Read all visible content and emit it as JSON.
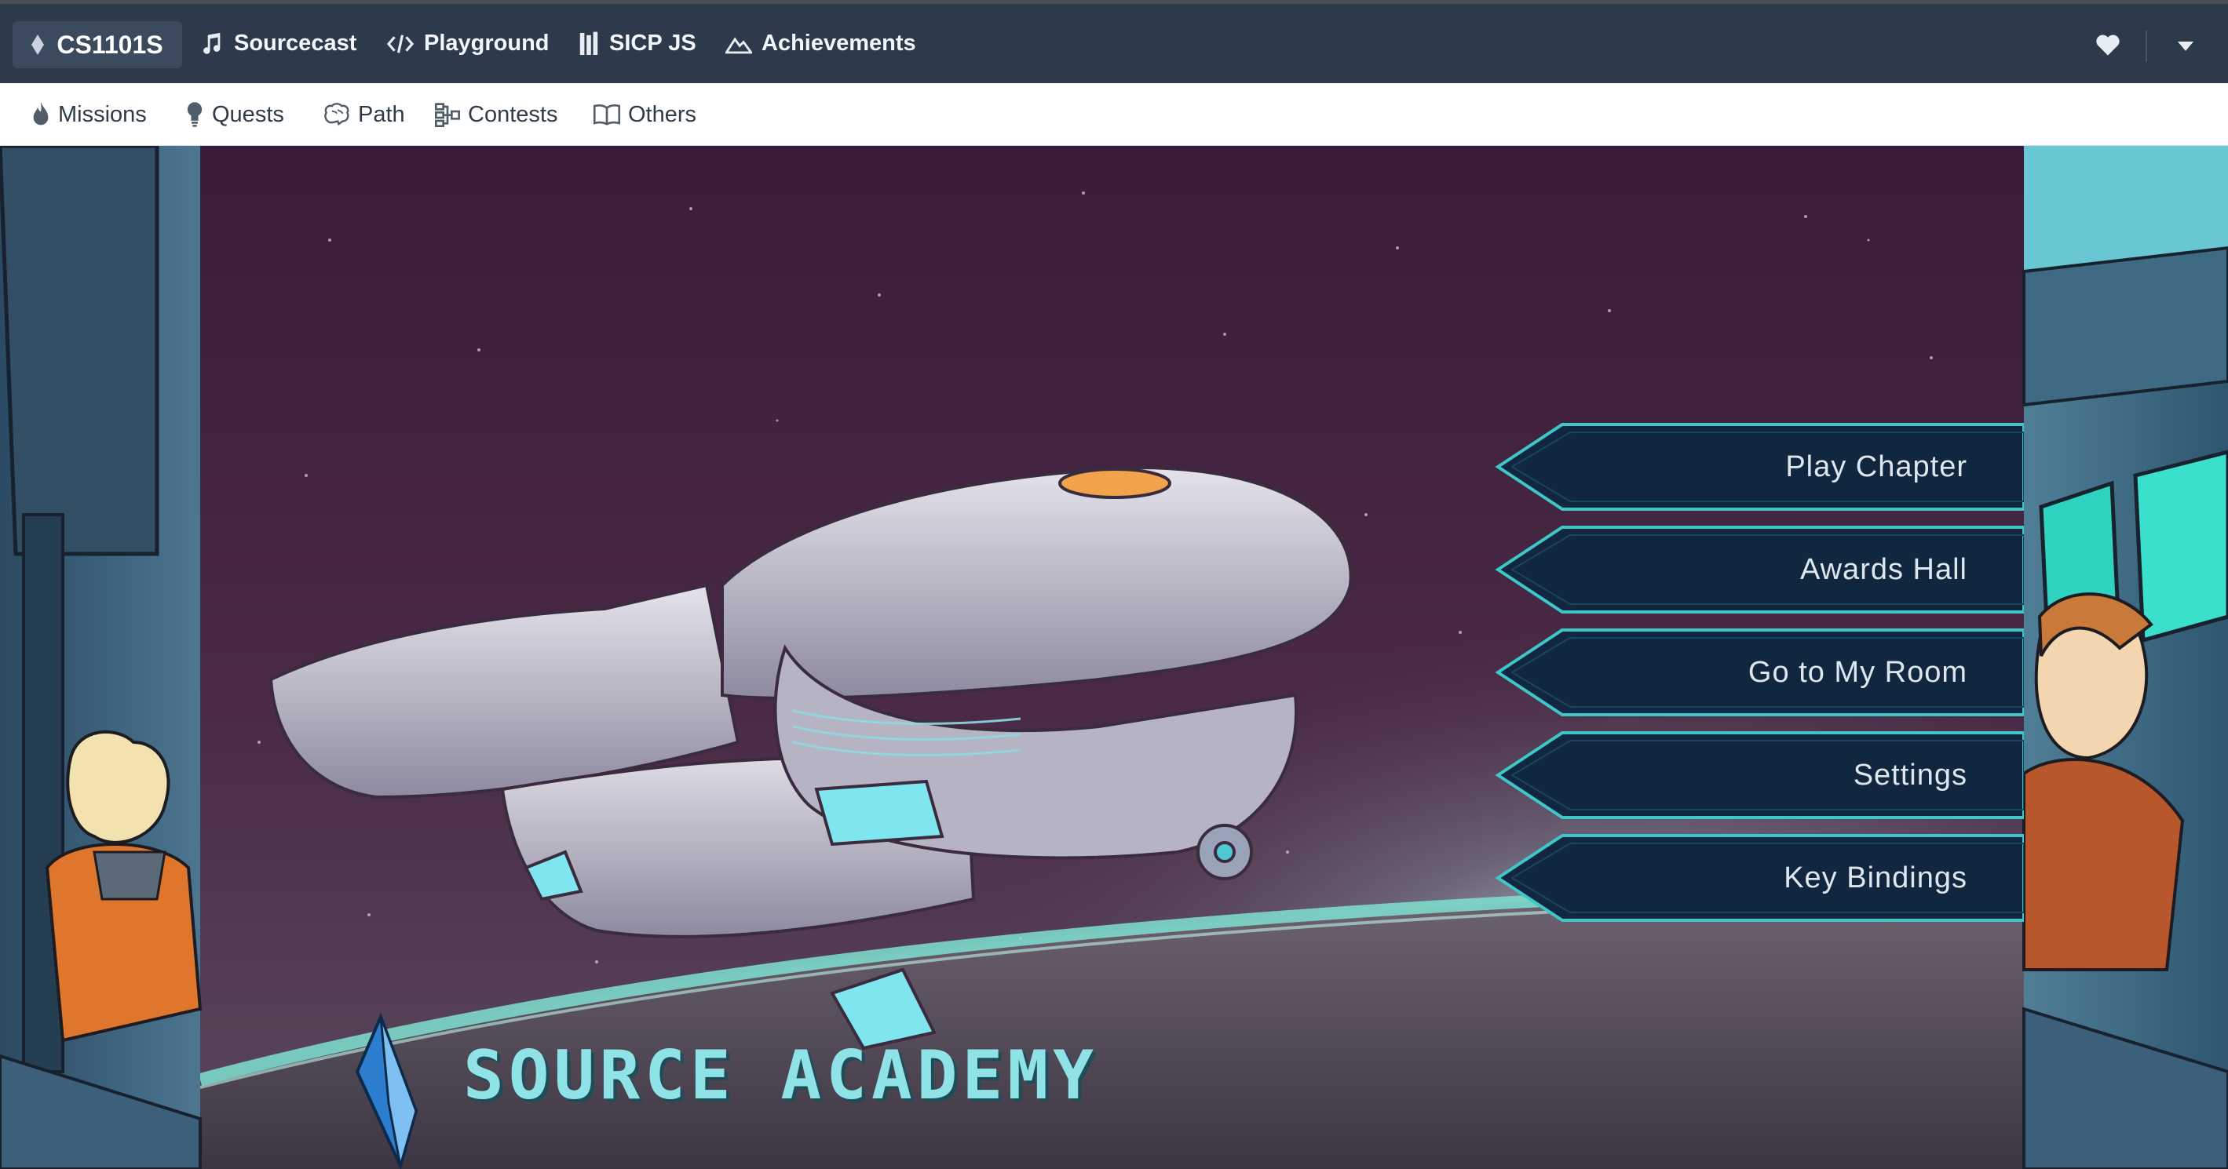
{
  "topbar": {
    "course": "CS1101S",
    "items": [
      {
        "label": "Sourcecast",
        "icon": "music-icon"
      },
      {
        "label": "Playground",
        "icon": "code-icon"
      },
      {
        "label": "SICP JS",
        "icon": "book-stack-icon"
      },
      {
        "label": "Achievements",
        "icon": "mountain-icon"
      }
    ],
    "right_icons": [
      "heart-icon",
      "caret-down-icon"
    ]
  },
  "subnav": {
    "items": [
      {
        "label": "Missions",
        "icon": "flame-icon"
      },
      {
        "label": "Quests",
        "icon": "lightbulb-icon"
      },
      {
        "label": "Path",
        "icon": "brain-icon"
      },
      {
        "label": "Contests",
        "icon": "contest-icon"
      },
      {
        "label": "Others",
        "icon": "open-book-icon"
      }
    ]
  },
  "game": {
    "menu": [
      {
        "label": "Play Chapter"
      },
      {
        "label": "Awards Hall"
      },
      {
        "label": "Go to My Room"
      },
      {
        "label": "Settings"
      },
      {
        "label": "Key Bindings"
      }
    ],
    "logo_text": "SOURCE ACADEMY"
  },
  "colors": {
    "topbar_bg": "#2c3a4b",
    "space_bg": "#3a1f38",
    "menu_fill": "#112740",
    "menu_border": "#3ec7c8",
    "planet_glow": "#7fe0d0"
  }
}
